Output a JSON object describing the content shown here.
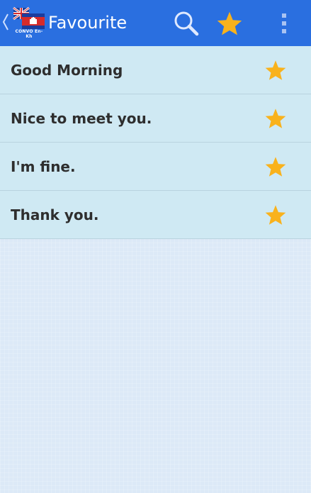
{
  "action_bar": {
    "title": "Favourite",
    "logo_caption": "CONVO En-Kh",
    "background_color": "#2a6fe0",
    "icons": {
      "back": "chevron-left-icon",
      "logo": "app-logo-icon",
      "search": "search-icon",
      "favourites": "star-icon",
      "overflow": "overflow-menu-icon"
    }
  },
  "favourites": {
    "items": [
      {
        "label": "Good Morning"
      },
      {
        "label": "Nice to meet you."
      },
      {
        "label": "I'm fine."
      },
      {
        "label": "Thank you."
      }
    ],
    "star_color": "#f9b21c",
    "item_background": "#cfe9f3"
  }
}
